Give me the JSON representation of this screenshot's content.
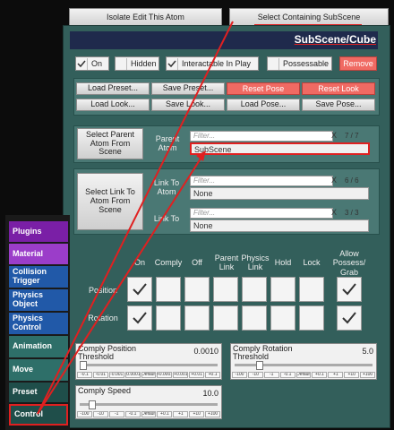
{
  "top_buttons": {
    "isolate": "Isolate Edit This Atom",
    "select_sub": "Select Containing SubScene"
  },
  "header": {
    "title": "SubScene/Cube"
  },
  "toggles": {
    "on": "On",
    "hidden": "Hidden",
    "interactable": "Interactable In Play",
    "possessable": "Possessable",
    "remove": "Remove"
  },
  "preset_buttons": {
    "load_preset": "Load Preset...",
    "save_preset": "Save Preset...",
    "reset_pose": "Reset Pose",
    "reset_look": "Reset Look",
    "load_look": "Load Look...",
    "save_look": "Save Look...",
    "load_pose": "Load Pose...",
    "save_pose": "Save Pose..."
  },
  "parent": {
    "button": "Select Parent Atom From Scene",
    "label": "Parent Atom",
    "filter_placeholder": "Filter...",
    "count": "7 / 7",
    "clear": "X",
    "value": "SubScene"
  },
  "link": {
    "button": "Select Link To Atom From Scene",
    "atom_label": "Link To Atom",
    "atom_filter": "Filter...",
    "atom_count": "6 / 6",
    "atom_value": "None",
    "link_label": "Link To",
    "link_filter": "Filter...",
    "link_count": "3 / 3",
    "link_value": "None",
    "clear": "X"
  },
  "comply": {
    "headers": [
      "On",
      "Comply",
      "Off",
      "Parent Link",
      "Physics Link",
      "Hold",
      "Lock",
      "Allow Possess/ Grab"
    ],
    "row_position": "Position",
    "row_rotation": "Rotation",
    "position_checked": [
      true,
      false,
      false,
      false,
      false,
      false,
      false,
      true
    ],
    "rotation_checked": [
      true,
      false,
      false,
      false,
      false,
      false,
      false,
      true
    ]
  },
  "sliders": {
    "pos_threshold": {
      "title": "Comply Position Threshold",
      "value": "0.0010"
    },
    "rot_threshold": {
      "title": "Comply Rotation Threshold",
      "value": "5.0"
    },
    "speed": {
      "title": "Comply Speed",
      "value": "10.0"
    },
    "steps_pos": [
      "-0.1",
      "-0.01",
      "-0.001",
      "-0.0001",
      "Default",
      "+0.0001",
      "+0.001",
      "+0.01",
      "+0.1"
    ],
    "steps_rot": [
      "-100",
      "-10",
      "-1",
      "-0.1",
      "Default",
      "+0.1",
      "+1",
      "+10",
      "+100"
    ],
    "steps_speed": [
      "-100",
      "-10",
      "-1",
      "-0.1",
      "Default",
      "+0.1",
      "+1",
      "+10",
      "+100"
    ]
  },
  "tabs": [
    {
      "label": "Plugins",
      "color": "#7a1fa6"
    },
    {
      "label": "Material",
      "color": "#9b3dc9"
    },
    {
      "label": "Collision Trigger",
      "color": "#2159a8"
    },
    {
      "label": "Physics Object",
      "color": "#2159a8"
    },
    {
      "label": "Physics Control",
      "color": "#2159a8"
    },
    {
      "label": "Animation",
      "color": "#2e6f69"
    },
    {
      "label": "Move",
      "color": "#2e6f69"
    },
    {
      "label": "Preset",
      "color": "#1f4e4a"
    },
    {
      "label": "Control",
      "color": "#1f4e4a"
    }
  ],
  "colors": {
    "accent_red": "#e02020",
    "panel": "#335f5b",
    "remove": "#f06a63"
  }
}
